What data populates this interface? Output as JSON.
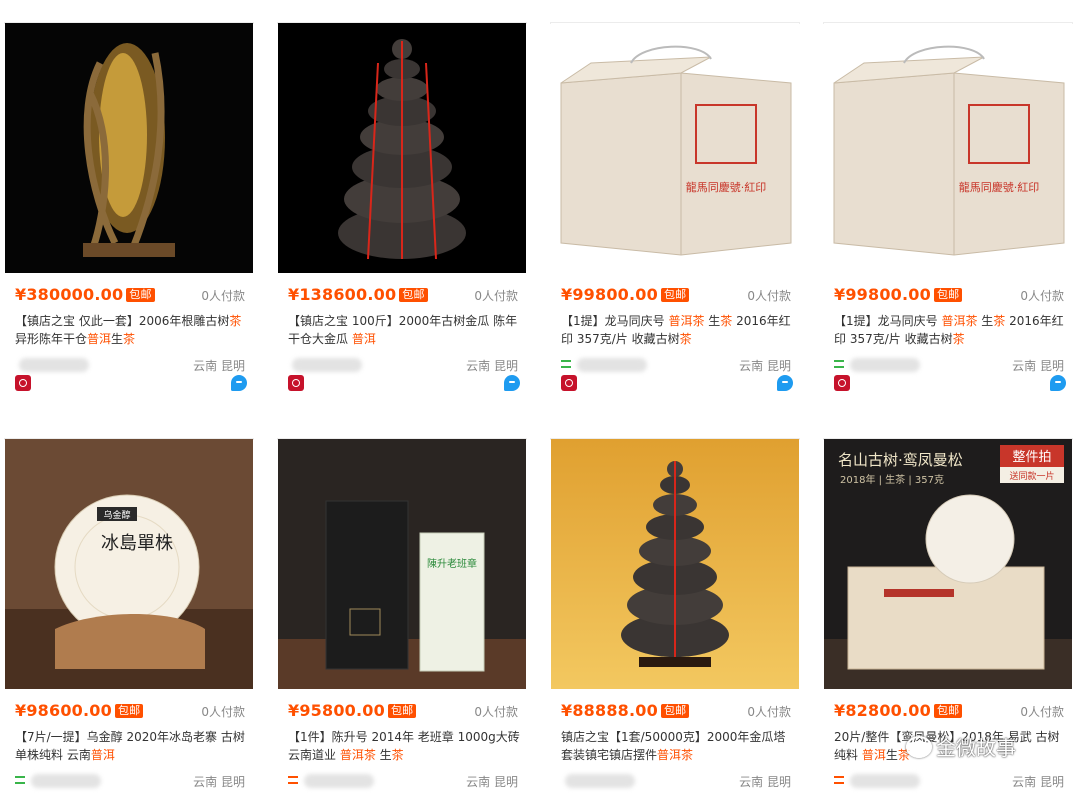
{
  "products": [
    {
      "price": "¥380000.00",
      "shipping": "包邮",
      "paid": "0人付款",
      "title_parts": [
        [
          "【镇店之宝 仅此一套】2006年根雕古树",
          false
        ],
        [
          "茶",
          true
        ],
        [
          "异形陈年干仓",
          false
        ],
        [
          "普洱",
          true
        ],
        [
          "生",
          false
        ],
        [
          "茶",
          true
        ]
      ],
      "location": "云南 昆明",
      "shop_icon": "none"
    },
    {
      "price": "¥138600.00",
      "shipping": "包邮",
      "paid": "0人付款",
      "title_parts": [
        [
          "【镇店之宝 100斤】2000年古树金瓜 陈年干仓大金瓜 ",
          false
        ],
        [
          "普洱",
          true
        ]
      ],
      "location": "云南 昆明",
      "shop_icon": "none"
    },
    {
      "price": "¥99800.00",
      "shipping": "包邮",
      "paid": "0人付款",
      "title_parts": [
        [
          "【1提】龙马同庆号 ",
          false
        ],
        [
          "普洱茶",
          true
        ],
        [
          " 生",
          false
        ],
        [
          "茶",
          true
        ],
        [
          " 2016年红印 357克/片 收藏古树",
          false
        ],
        [
          "茶",
          true
        ]
      ],
      "location": "云南 昆明",
      "shop_icon": "list-icon"
    },
    {
      "price": "¥99800.00",
      "shipping": "包邮",
      "paid": "0人付款",
      "title_parts": [
        [
          "【1提】龙马同庆号 ",
          false
        ],
        [
          "普洱茶",
          true
        ],
        [
          " 生",
          false
        ],
        [
          "茶",
          true
        ],
        [
          " 2016年红印 357克/片 收藏古树",
          false
        ],
        [
          "茶",
          true
        ]
      ],
      "location": "云南 昆明",
      "shop_icon": "list-icon"
    },
    {
      "price": "¥98600.00",
      "shipping": "包邮",
      "paid": "0人付款",
      "title_parts": [
        [
          "【7片/一提】乌金醇 2020年冰岛老寨 古树单株纯料 云南",
          false
        ],
        [
          "普洱",
          true
        ]
      ],
      "location": "云南 昆明",
      "shop_icon": "list-icon"
    },
    {
      "price": "¥95800.00",
      "shipping": "包邮",
      "paid": "0人付款",
      "title_parts": [
        [
          "【1件】陈升号 2014年 老班章 1000g大砖 云南道业 ",
          false
        ],
        [
          "普洱茶",
          true
        ],
        [
          " 生",
          false
        ],
        [
          "茶",
          true
        ]
      ],
      "location": "云南 昆明",
      "shop_icon": "list-icon-orange"
    },
    {
      "price": "¥88888.00",
      "shipping": "包邮",
      "paid": "0人付款",
      "title_parts": [
        [
          "镇店之宝【1套/50000克】2000年金瓜塔套装镇宅镇店摆件",
          false
        ],
        [
          "普洱茶",
          true
        ]
      ],
      "location": "云南 昆明",
      "shop_icon": "none"
    },
    {
      "price": "¥82800.00",
      "shipping": "包邮",
      "paid": "0人付款",
      "title_parts": [
        [
          "20片/整件【",
          false
        ],
        [
          "鸾凤曼松",
          false
        ],
        [
          "】2018年 易武 古树纯料 ",
          false
        ],
        [
          "普洱",
          true
        ],
        [
          "生",
          false
        ],
        [
          "茶",
          true
        ]
      ],
      "location": "云南 昆明",
      "shop_icon": "list-icon-orange"
    }
  ],
  "image_texts": {
    "tray_label": "龍馬同慶號·紅印",
    "bing_brand": "乌金醇",
    "bing_title": "冰島單株",
    "cs_label": "陳升老班章",
    "mang_banner": "名山古树·鸾凤曼松",
    "mang_sub": "2018年 | 生茶 | 357克",
    "mang_tag": "整件拍",
    "mang_tag2": "送同款一片"
  },
  "watermark": "金微故事",
  "colors": {
    "price": "#ff5000",
    "tmall": "#c6122b",
    "wangwang": "#1e9bf0"
  }
}
